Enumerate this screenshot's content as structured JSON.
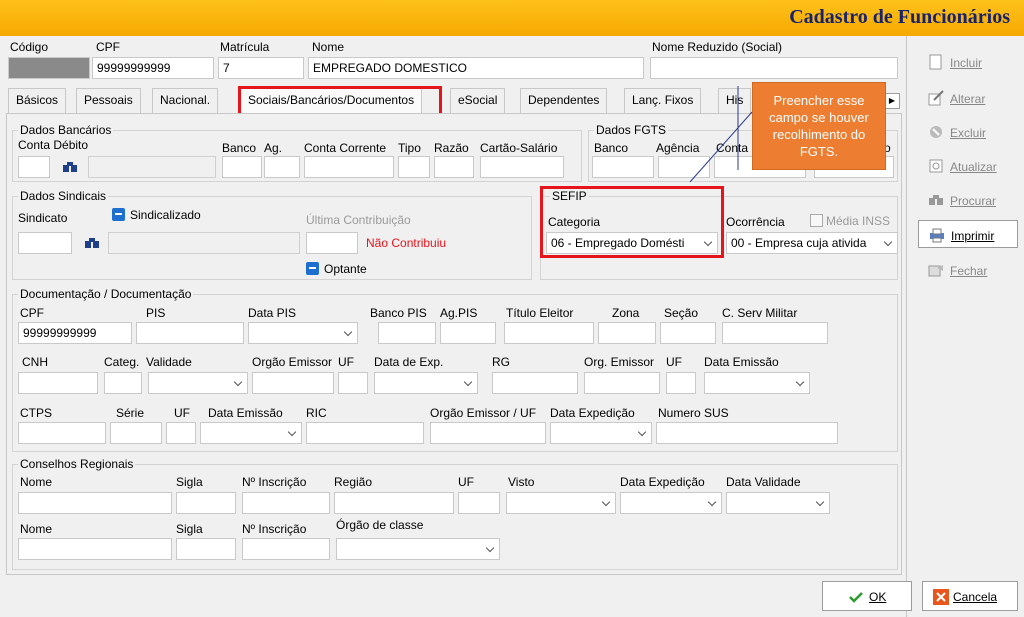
{
  "window": {
    "title": "Cadastro de Funcionários"
  },
  "header": {
    "codigo_label": "Código",
    "cpf_label": "CPF",
    "cpf_value": "99999999999",
    "matricula_label": "Matrícula",
    "matricula_value": "7",
    "nome_label": "Nome",
    "nome_value": "EMPREGADO DOMESTICO",
    "nome_reduzido_label": "Nome Reduzido (Social)",
    "nome_reduzido_value": ""
  },
  "tabs": [
    {
      "label": "Básicos"
    },
    {
      "label": "Pessoais"
    },
    {
      "label": "Nacional."
    },
    {
      "label": "Sociais/Bancários/Documentos"
    },
    {
      "label": "eSocial"
    },
    {
      "label": "Dependentes"
    },
    {
      "label": "Lanç. Fixos"
    },
    {
      "label": "His"
    }
  ],
  "callout": {
    "text": "Preencher esse campo se houver recolhimento do FGTS."
  },
  "dados_bancarios": {
    "title": "Dados Bancários",
    "conta_debito": "Conta Débito",
    "banco": "Banco",
    "ag": "Ag.",
    "conta_corrente": "Conta Corrente",
    "tipo": "Tipo",
    "razao": "Razão",
    "cartao_salario": "Cartão-Salário"
  },
  "dados_fgts": {
    "title": "Dados FGTS",
    "banco": "Banco",
    "agencia": "Agência",
    "conta": "Conta",
    "extra": "o"
  },
  "dados_sindicais": {
    "title": "Dados Sindicais",
    "sindicato": "Sindicato",
    "sindicalizado": "Sindicalizado",
    "ultima_contribuicao": "Última Contribuição",
    "nao_contribuiu": "Não Contribuiu",
    "optante": "Optante"
  },
  "sefip": {
    "title": "SEFIP",
    "categoria_label": "Categoria",
    "categoria_value": "06 - Empregado Domésti",
    "ocorrencia_label": "Ocorrência",
    "ocorrencia_value": "00 - Empresa cuja ativida",
    "media_inss": "Média INSS"
  },
  "documentacao": {
    "title": "Documentação / Documentação",
    "cpf": "CPF",
    "cpf_value": "99999999999",
    "pis": "PIS",
    "data_pis": "Data PIS",
    "banco_pis": "Banco PIS",
    "ag_pis": "Ag.PIS",
    "titulo_eleitor": "Título Eleitor",
    "zona": "Zona",
    "secao": "Seção",
    "c_serv_militar": "C. Serv Militar",
    "cnh": "CNH",
    "categ": "Categ.",
    "validade": "Validade",
    "orgao_emissor": "Orgão Emissor",
    "uf": "UF",
    "data_exp": "Data de Exp.",
    "rg": "RG",
    "org_emissor": "Org. Emissor",
    "uf2": "UF",
    "data_emissao": "Data Emissão",
    "ctps": "CTPS",
    "serie": "Série",
    "uf3": "UF",
    "data_emissao2": "Data Emissão",
    "ric": "RIC",
    "orgao_emissor_uf": "Orgão Emissor / UF",
    "data_expedicao": "Data Expedição",
    "numero_sus": "Numero SUS"
  },
  "conselhos": {
    "title": "Conselhos Regionais",
    "nome": "Nome",
    "sigla": "Sigla",
    "inscricao": "Nº Inscrição",
    "regiao": "Região",
    "uf": "UF",
    "visto": "Visto",
    "data_expedicao": "Data Expedição",
    "data_validade": "Data Validade",
    "nome2": "Nome",
    "sigla2": "Sigla",
    "inscricao2": "Nº Inscrição",
    "orgao_classe": "Órgão de classe"
  },
  "sidebar": {
    "incluir": "Incluir",
    "alterar": "Alterar",
    "excluir": "Excluir",
    "atualizar": "Atualizar",
    "procurar": "Procurar",
    "imprimir": "Imprimir",
    "fechar": "Fechar"
  },
  "footer": {
    "ok": "OK",
    "cancela": "Cancela"
  },
  "colors": {
    "title_bg": "#f5a800",
    "title_text": "#17236e",
    "highlight": "#e8141c",
    "callout": "#ed7d31"
  }
}
